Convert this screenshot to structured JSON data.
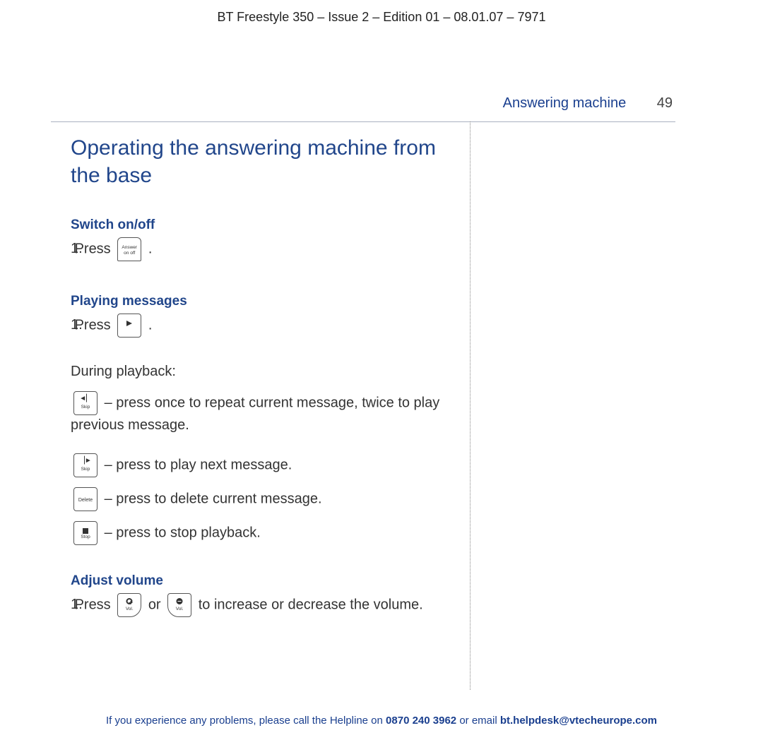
{
  "doc_header": "BT Freestyle 350 – Issue 2 – Edition 01 – 08.01.07 – 7971",
  "section_name": "Answering machine",
  "page_number": "49",
  "main_heading": "Operating the answering machine from the base",
  "sections": {
    "switch": {
      "heading": "Switch on/off",
      "step_num": "1.",
      "step_text_before": "Press ",
      "step_text_after": " .",
      "icon_labels": {
        "top": "Answer",
        "bot": "on    off"
      }
    },
    "playing": {
      "heading": "Playing messages",
      "step_num": "1.",
      "step_text_before": "Press ",
      "step_text_after": ".",
      "during_label": "During playback:",
      "items": [
        {
          "icon_label": "Skip",
          "text": " – press once to repeat current message, twice to play previous message."
        },
        {
          "icon_label": "Skip",
          "text": " – press to play next message."
        },
        {
          "icon_label": "Delete",
          "text": " – press to delete current message."
        },
        {
          "icon_label": "Stop",
          "text": " – press to stop playback."
        }
      ]
    },
    "volume": {
      "heading": "Adjust volume",
      "step_num": "1.",
      "text_before": "Press ",
      "text_mid": " or ",
      "text_after": " to increase or decrease the volume.",
      "icon_label": "Vol."
    }
  },
  "footer": {
    "pre": "If you experience any problems, please call the Helpline on ",
    "phone": "0870 240 3962",
    "mid": " or email ",
    "email": "bt.helpdesk@vtecheurope.com"
  }
}
